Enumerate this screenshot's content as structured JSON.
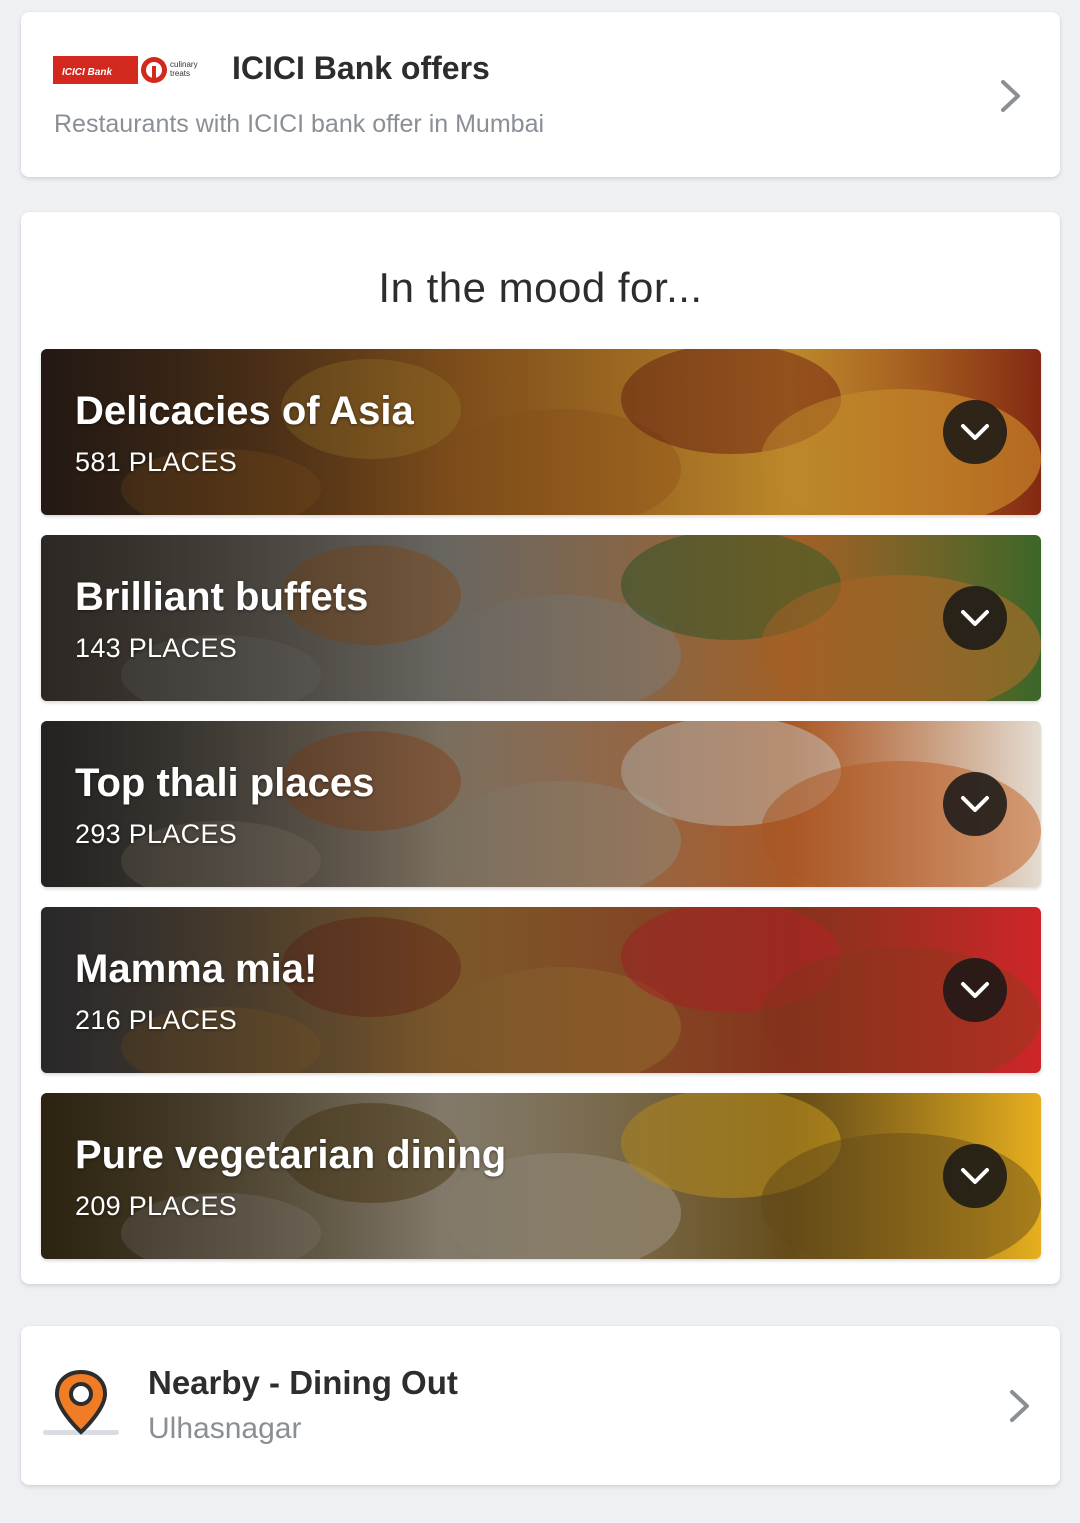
{
  "bank_offer": {
    "logo_text": "ICICI Bank",
    "logo_partner_text": "culinary treats",
    "title": "ICICI Bank offers",
    "subtitle": "Restaurants with ICICI bank offer in Mumbai",
    "brand_color": "#d2281e"
  },
  "mood": {
    "heading": "In the mood for...",
    "collections": [
      {
        "title": "Delicacies of Asia",
        "count": "581 PLACES",
        "palette": [
          "#4a2614",
          "#c8741e",
          "#e9a630",
          "#8a2a12"
        ]
      },
      {
        "title": "Brilliant buffets",
        "count": "143 PLACES",
        "palette": [
          "#6b5a48",
          "#a9a49a",
          "#c9742a",
          "#3d6b2a"
        ]
      },
      {
        "title": "Top thali places",
        "count": "293 PLACES",
        "palette": [
          "#4a4640",
          "#c7b397",
          "#d26a2a",
          "#efe7dc"
        ]
      },
      {
        "title": "Mamma mia!",
        "count": "216 PLACES",
        "palette": [
          "#5c5c62",
          "#c98a3a",
          "#a33a1e",
          "#d8262a"
        ]
      },
      {
        "title": "Pure vegetarian dining",
        "count": "209 PLACES",
        "palette": [
          "#6a4a0a",
          "#d6c7ad",
          "#7a5a1a",
          "#f3b81f"
        ]
      }
    ]
  },
  "nearby": {
    "title": "Nearby - Dining Out",
    "location": "Ulhasnagar",
    "pin_color": "#f07d25"
  }
}
